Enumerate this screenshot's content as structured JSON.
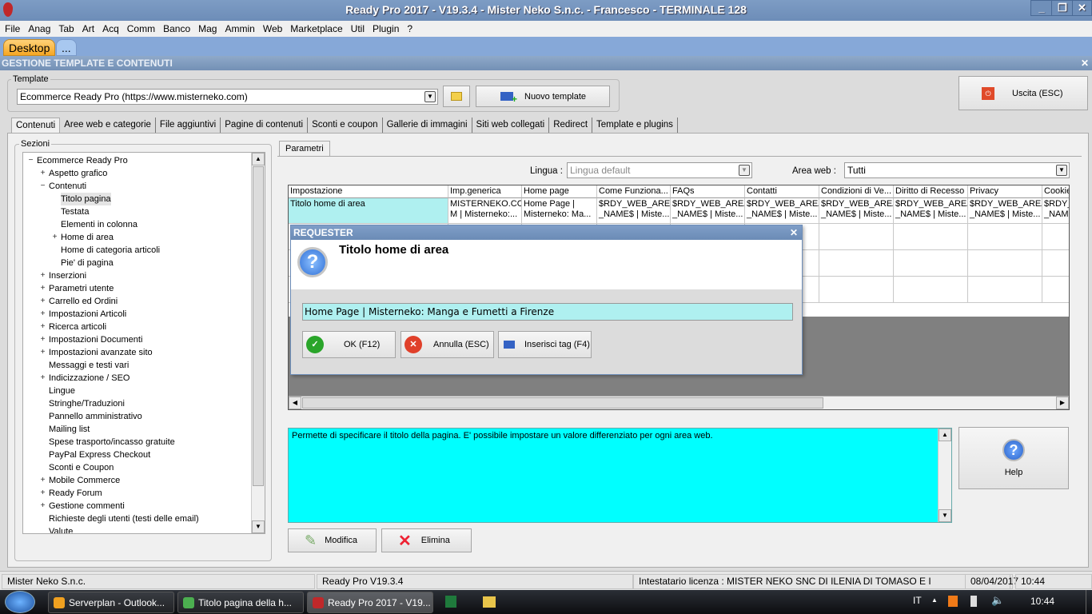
{
  "window": {
    "title": "Ready Pro 2017 - V19.3.4 - Mister Neko S.n.c. - Francesco - TERMINALE 128"
  },
  "menu": [
    "File",
    "Anag",
    "Tab",
    "Art",
    "Acq",
    "Comm",
    "Banco",
    "Mag",
    "Ammin",
    "Web",
    "Marketplace",
    "Util",
    "Plugin",
    "?"
  ],
  "desktop_tabs": [
    "Desktop",
    "..."
  ],
  "module_title": "GESTIONE TEMPLATE E CONTENUTI",
  "template": {
    "legend": "Template",
    "value": "Ecommerce Ready Pro (https://www.misterneko.com)",
    "new_label": "Nuovo template",
    "exit_label": "Uscita (ESC)"
  },
  "tabs": [
    "Contenuti",
    "Aree web e categorie",
    "File aggiuntivi",
    "Pagine di contenuti",
    "Sconti e coupon",
    "Gallerie di immagini",
    "Siti web collegati",
    "Redirect",
    "Template e plugins"
  ],
  "sections": {
    "legend": "Sezioni",
    "items": [
      {
        "label": "Ecommerce Ready Pro",
        "level": 0,
        "exp": "-"
      },
      {
        "label": "Aspetto grafico",
        "level": 1,
        "exp": "+"
      },
      {
        "label": "Contenuti",
        "level": 1,
        "exp": "-"
      },
      {
        "label": "Titolo pagina",
        "level": 2,
        "exp": "",
        "selected": true
      },
      {
        "label": "Testata",
        "level": 2,
        "exp": ""
      },
      {
        "label": "Elementi in colonna",
        "level": 2,
        "exp": ""
      },
      {
        "label": "Home di area",
        "level": 2,
        "exp": "+"
      },
      {
        "label": "Home di categoria articoli",
        "level": 2,
        "exp": ""
      },
      {
        "label": "Pie' di pagina",
        "level": 2,
        "exp": ""
      },
      {
        "label": "Inserzioni",
        "level": 1,
        "exp": "+"
      },
      {
        "label": "Parametri utente",
        "level": 1,
        "exp": "+"
      },
      {
        "label": "Carrello ed Ordini",
        "level": 1,
        "exp": "+"
      },
      {
        "label": "Impostazioni Articoli",
        "level": 1,
        "exp": "+"
      },
      {
        "label": "Ricerca articoli",
        "level": 1,
        "exp": "+"
      },
      {
        "label": "Impostazioni Documenti",
        "level": 1,
        "exp": "+"
      },
      {
        "label": "Impostazioni avanzate sito",
        "level": 1,
        "exp": "+"
      },
      {
        "label": "Messaggi e testi vari",
        "level": 1,
        "exp": ""
      },
      {
        "label": "Indicizzazione / SEO",
        "level": 1,
        "exp": "+"
      },
      {
        "label": "Lingue",
        "level": 1,
        "exp": ""
      },
      {
        "label": "Stringhe/Traduzioni",
        "level": 1,
        "exp": ""
      },
      {
        "label": "Pannello amministrativo",
        "level": 1,
        "exp": ""
      },
      {
        "label": "Mailing list",
        "level": 1,
        "exp": ""
      },
      {
        "label": "Spese trasporto/incasso gratuite",
        "level": 1,
        "exp": ""
      },
      {
        "label": "PayPal Express Checkout",
        "level": 1,
        "exp": ""
      },
      {
        "label": "Sconti e Coupon",
        "level": 1,
        "exp": ""
      },
      {
        "label": "Mobile Commerce",
        "level": 1,
        "exp": "+"
      },
      {
        "label": "Ready Forum",
        "level": 1,
        "exp": "+"
      },
      {
        "label": "Gestione commenti",
        "level": 1,
        "exp": "+"
      },
      {
        "label": "Richieste degli utenti (testi delle email)",
        "level": 1,
        "exp": ""
      },
      {
        "label": "Valute",
        "level": 1,
        "exp": ""
      }
    ]
  },
  "params": {
    "tab": "Parametri",
    "lingua_label": "Lingua :",
    "lingua_value": "Lingua default",
    "area_label": "Area web :",
    "area_value": "Tutti"
  },
  "grid": {
    "columns": [
      "Impostazione",
      "Imp.generica",
      "Home page",
      "Come Funziona...",
      "FAQs",
      "Contatti",
      "Condizioni di Ve...",
      "Diritto di Recesso",
      "Privacy",
      "Cookie"
    ],
    "rows": [
      [
        "Titolo home di area",
        "MISTERNEKO.CO\nM | Misterneko:...",
        "Home Page |\nMisterneko: Ma...",
        "$RDY_WEB_AREA\n_NAME$ | Miste...",
        "$RDY_WEB_AREA\n_NAME$ | Miste...",
        "$RDY_WEB_AREA\n_NAME$ | Miste...",
        "$RDY_WEB_AREA\n_NAME$ | Miste...",
        "$RDY_WEB_AREA\n_NAME$ | Miste...",
        "$RDY_WEB_AREA\n_NAME$ | Miste...",
        "$RDY_\n_NAM"
      ]
    ]
  },
  "description": "Permette di specificare il titolo della pagina. E' possibile impostare un valore differenziato per ogni area web.",
  "help_label": "Help",
  "modifica_label": "Modifica",
  "elimina_label": "Elimina",
  "dialog": {
    "title": "REQUESTER",
    "heading": "Titolo home di area",
    "value": "Home Page | Misterneko: Manga e Fumetti a Firenze",
    "ok": "OK (F12)",
    "cancel": "Annulla (ESC)",
    "insert": "Inserisci tag (F4)"
  },
  "status": [
    "Mister Neko S.n.c.",
    "Ready Pro V19.3.4",
    "Intestatario licenza : MISTER NEKO SNC DI ILENIA DI TOMASO E I",
    "08/04/2017",
    "10:44"
  ],
  "taskbar": {
    "items": [
      "Serverplan - Outlook...",
      "Titolo pagina della h...",
      "Ready Pro 2017 - V19..."
    ],
    "lang": "IT",
    "clock": "10:44"
  }
}
